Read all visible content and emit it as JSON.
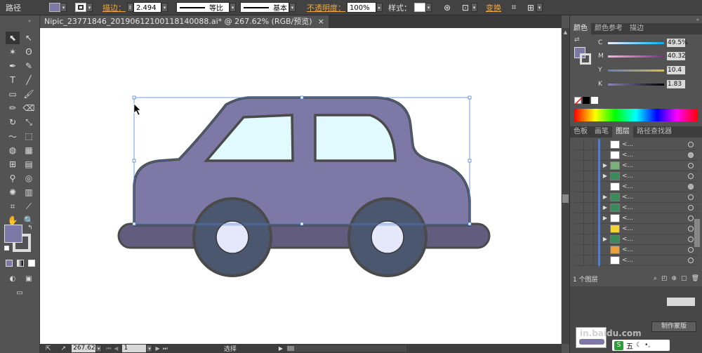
{
  "control_bar": {
    "object_type": "路径",
    "stroke_label": "描边：",
    "stroke_weight": "2.494",
    "stroke_profile": "等比",
    "brush_profile": "基本",
    "opacity_label": "不透明度：",
    "opacity_value": "100%",
    "style_label": "样式：",
    "transform_label": "变换",
    "fill_color": "#7e78a6",
    "stroke_color": "#ffffff"
  },
  "document_tab": {
    "title": "Nipic_23771846_20190612100118140088.ai* @ 267.62% (RGB/预览)",
    "close_symbol": "×"
  },
  "status_bar": {
    "zoom": "267.62",
    "page": "1",
    "tool_name": "选择"
  },
  "color_panel": {
    "tabs": [
      "颜色",
      "颜色参考",
      "描边"
    ],
    "channels": [
      {
        "label": "C",
        "value": "49.5%"
      },
      {
        "label": "M",
        "value": "40.32"
      },
      {
        "label": "Y",
        "value": "10.4"
      },
      {
        "label": "K",
        "value": "1.83"
      }
    ]
  },
  "layers_panel": {
    "tabs": [
      "色板",
      "画笔",
      "图层",
      "路径查找器"
    ],
    "row_name": "<...",
    "row_count": 12,
    "footer_text": "1 个图层",
    "footer_button": "制作蒙版"
  },
  "watermark": {
    "text": "in.baidu.com"
  },
  "ime_bar": {
    "text": "五"
  },
  "colors": {
    "car_body": "#7e78a6",
    "car_outline": "#4a4a4a",
    "window": "#e0fafd",
    "base": "#625d7f",
    "wheel": "#4b566f",
    "hub": "#e5e8fa",
    "selection": "#4d7fd6"
  }
}
